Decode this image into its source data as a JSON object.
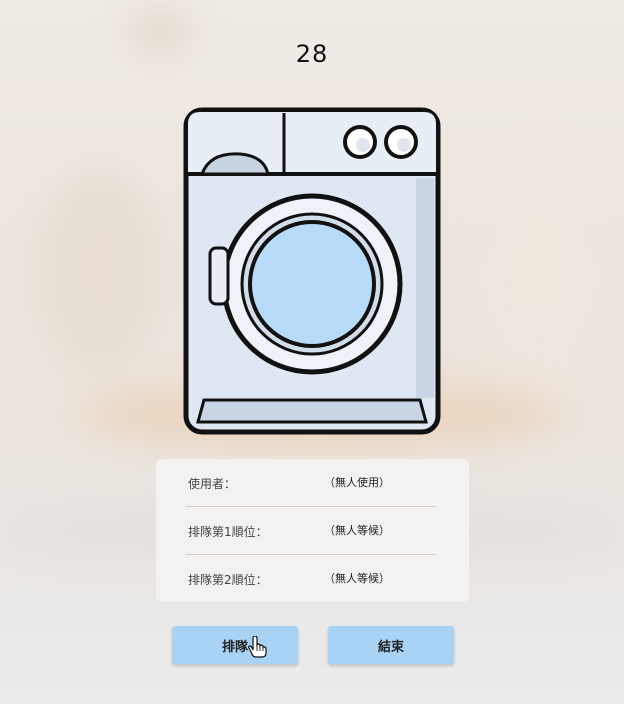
{
  "machine": {
    "number": "28"
  },
  "info": {
    "user_label": "使用者：",
    "user_value": "（無人使用）",
    "queue1_label": "排隊第1順位：",
    "queue1_value": "（無人等候）",
    "queue2_label": "排隊第2順位：",
    "queue2_value": "（無人等候）"
  },
  "actions": {
    "queue_label": "排隊",
    "end_label": "結束"
  },
  "colors": {
    "button_bg": "#a9d3f5",
    "washer_window": "#b7dbf8",
    "washer_body": "#dfe7f2"
  },
  "icons": {
    "cursor": "hand-pointer-icon",
    "washer": "washing-machine-icon"
  }
}
